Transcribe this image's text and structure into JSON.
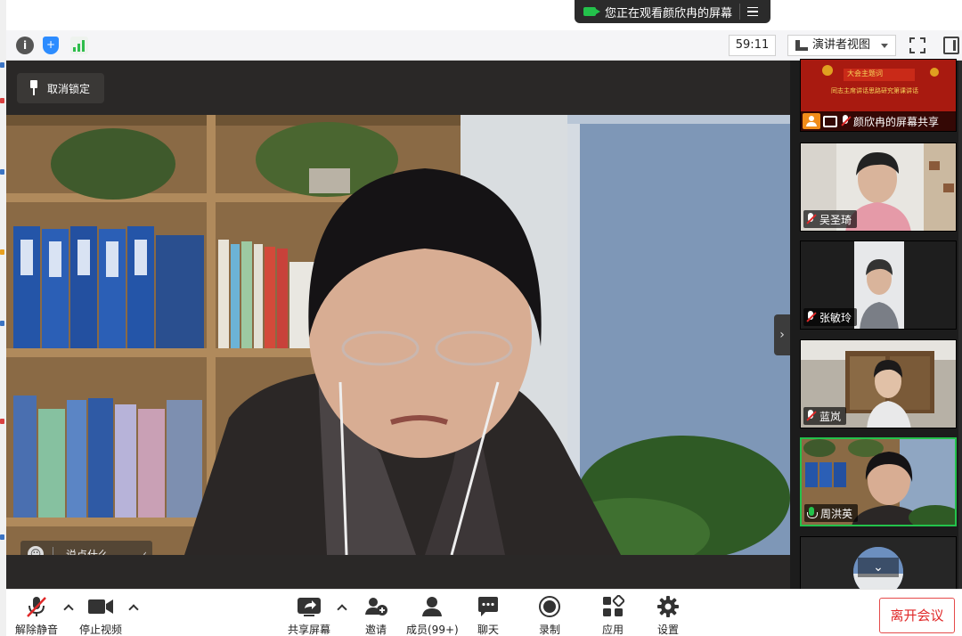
{
  "banner": {
    "text": "您正在观看颜欣冉的屏幕"
  },
  "topbar": {
    "timer": "59:11",
    "view_mode": "演讲者视图"
  },
  "stage": {
    "unpin_label": "取消锁定",
    "chat_placeholder": "说点什么..."
  },
  "sidebar": {
    "share_tile": {
      "banner_line1": "大会主题词",
      "banner_line2": "同志主席讲话思路研究第课讲话",
      "caption": "颜欣冉的屏幕共享"
    },
    "participants": [
      {
        "name": "吴圣琦",
        "muted": true
      },
      {
        "name": "张敏玲",
        "muted": true
      },
      {
        "name": "蓝岚",
        "muted": true
      },
      {
        "name": "周洪英",
        "muted": false,
        "active": true
      }
    ]
  },
  "bottombar": {
    "mute_label": "解除静音",
    "video_label": "停止视频",
    "share_label": "共享屏幕",
    "invite_label": "邀请",
    "members_label": "成员(99+)",
    "chat_label": "聊天",
    "record_label": "录制",
    "apps_label": "应用",
    "settings_label": "设置",
    "leave_label": "离开会议"
  },
  "colors": {
    "accent_green": "#23c24b",
    "leave_red": "#e02828",
    "zoom_blue": "#2d8cff"
  }
}
